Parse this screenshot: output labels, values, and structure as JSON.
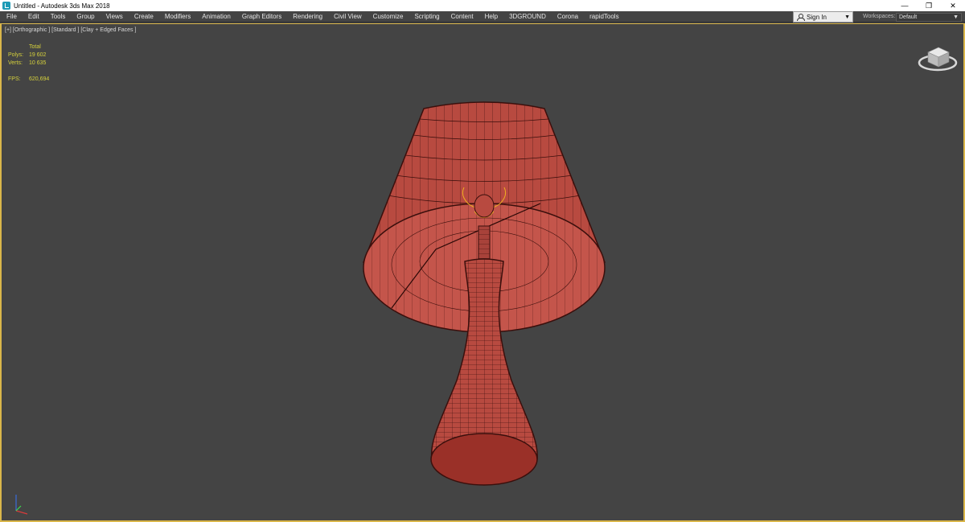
{
  "window": {
    "title": "Untitled - Autodesk 3ds Max 2018",
    "controls": [
      "—",
      "❐",
      "✕"
    ]
  },
  "menu": [
    "File",
    "Edit",
    "Tools",
    "Group",
    "Views",
    "Create",
    "Modifiers",
    "Animation",
    "Graph Editors",
    "Rendering",
    "Civil View",
    "Customize",
    "Scripting",
    "Content",
    "Help",
    "3DGROUND",
    "Corona",
    "rapidTools"
  ],
  "account": {
    "sign_in": "Sign In",
    "dropdown": "▼"
  },
  "workspaces": {
    "label": "Workspaces:",
    "value": "Default",
    "dropdown": "▼"
  },
  "viewport": {
    "label": "[+] [Orthographic ] [Standard ] [Clay + Edged Faces ]",
    "border_color": "#d9b64a",
    "stats": {
      "header": "Total",
      "polys_label": "Polys:",
      "polys": "19 602",
      "verts_label": "Verts:",
      "verts": "10 635",
      "fps_label": "FPS:",
      "fps": "620,694"
    }
  },
  "colors": {
    "viewport_bg": "#444444",
    "mesh_fill": "#b84a40",
    "wire": "#3a0f0c",
    "stats_text": "#d6d13c",
    "filament": "#f0b020"
  },
  "icons": [
    "app-icon",
    "user-icon",
    "viewcube-icon",
    "axis-tripod-icon"
  ]
}
